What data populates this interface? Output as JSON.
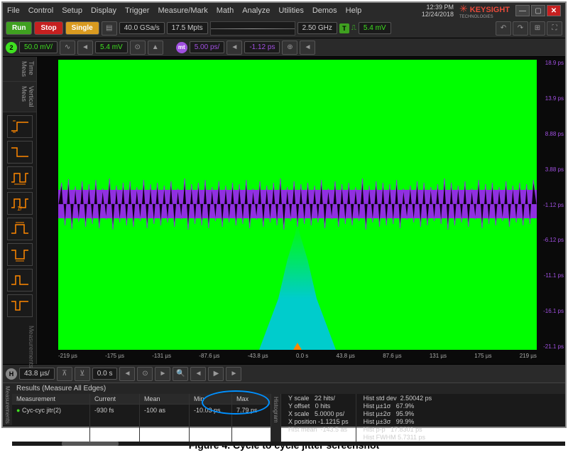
{
  "menu": {
    "items": [
      "File",
      "Control",
      "Setup",
      "Display",
      "Trigger",
      "Measure/Mark",
      "Math",
      "Analyze",
      "Utilities",
      "Demos",
      "Help"
    ]
  },
  "datetime": {
    "time": "12:39 PM",
    "date": "12/24/2018"
  },
  "brand": {
    "name": "KEYSIGHT",
    "sub": "TECHNOLOGIES"
  },
  "toolbar1": {
    "run": "Run",
    "stop": "Stop",
    "single": "Single",
    "sample_rate": "40.0 GSa/s",
    "mem_depth": "17.5 Mpts",
    "bandwidth": "2.50 GHz",
    "trigger_level": "5.4 mV",
    "trigger_badge": "T"
  },
  "toolbar2": {
    "ch2_scale": "50.0 mV/",
    "ch2_offset": "5.4 mV",
    "mt_scale": "5.00 ps/",
    "mt_offset": "-1.12 ps"
  },
  "toolbar3": {
    "h_scale": "43.8 µs/",
    "h_offset": "0.0 s"
  },
  "chart_data": {
    "type": "scope-waveform",
    "title": "Cycle-to-cycle jitter",
    "x_unit": "µs",
    "y_unit": "ps",
    "x_ticks": [
      "-219 µs",
      "-175 µs",
      "-131 µs",
      "-87.6 µs",
      "-43.8 µs",
      "0.0 s",
      "43.8 µs",
      "87.6 µs",
      "131 µs",
      "175 µs",
      "219 µs"
    ],
    "y_ticks": [
      "18.9 ps",
      "13.9 ps",
      "8.88 ps",
      "3.88 ps",
      "-1.12 ps",
      "-6.12 ps",
      "-11.1 ps",
      "-16.1 ps",
      "-21.1 ps"
    ],
    "notes": "Dense purple jitter trace centered near -1.12 ps; cyan vertical histogram centered at 0 s; green background channel saturated"
  },
  "results": {
    "header": "Results (Measure All Edges)",
    "columns": [
      "Measurement",
      "Current",
      "Mean",
      "Min",
      "Max"
    ],
    "row": {
      "name": "Cyc-cyc jitr(2)",
      "current": "-930 fs",
      "mean": "-100 as",
      "min": "-10.03 ps",
      "max": "7.79 ps"
    }
  },
  "hist_stats_left": [
    {
      "k": "Y scale",
      "v": "22 hits/"
    },
    {
      "k": "Y offset",
      "v": "0 hits"
    },
    {
      "k": "X scale",
      "v": "5.0000 ps/"
    },
    {
      "k": "X position",
      "v": "-1.1215 ps"
    },
    {
      "k": "Hist mean",
      "v": "-143.5 as"
    }
  ],
  "hist_stats_right": [
    {
      "k": "Hist std dev",
      "v": "2.50042 ps"
    },
    {
      "k": "Hist µ±1σ",
      "v": "67.9%"
    },
    {
      "k": "Hist µ±2σ",
      "v": "95.9%"
    },
    {
      "k": "Hist µ±3σ",
      "v": "99.9%"
    },
    {
      "k": "Hist p-p",
      "v": "17.8301 ps"
    },
    {
      "k": "Hist FWHM",
      "v": "5.7311 ps"
    }
  ],
  "side_tabs": {
    "time": "Time Meas",
    "vert": "Vertical Meas",
    "meas": "Measurements",
    "hist": "Histogram"
  },
  "caption": "Figure 4. Cycle to cycle jitter screenshot"
}
